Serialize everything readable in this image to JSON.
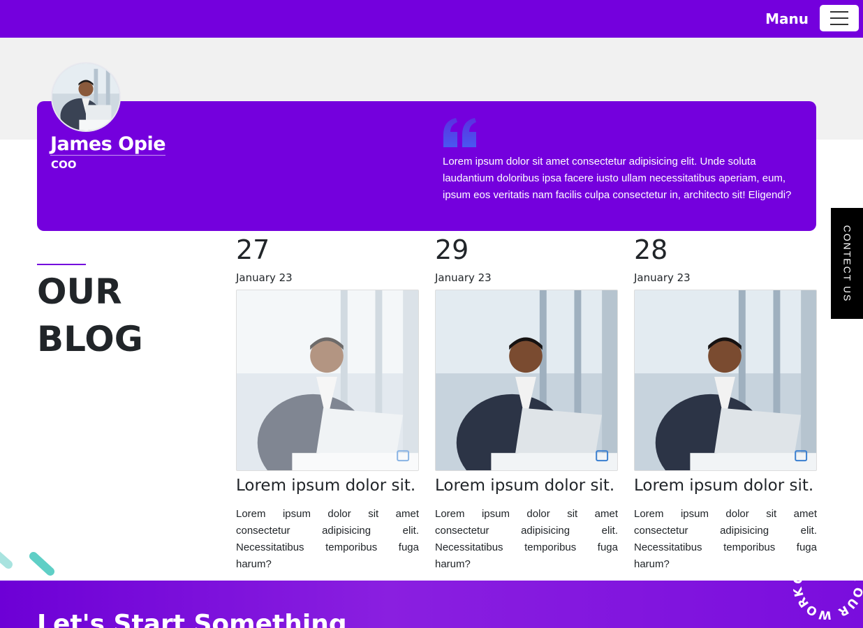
{
  "nav": {
    "menu_label": "Manu",
    "menu_icon": "hamburger-icon"
  },
  "testimonial": {
    "name": "James Opie",
    "role": "COO",
    "quote_icon": "quote-icon",
    "quote": "Lorem ipsum dolor sit amet consectetur adipisicing elit. Unde soluta laudantium doloribus ipsa facere iusto ullam necessitatibus aperiam, eum, ipsum eos veritatis nam facilis culpa consectetur in, architecto sit! Eligendi?"
  },
  "contact_tab": {
    "label": "CONTECT US"
  },
  "blog": {
    "heading_line1": "OUR",
    "heading_line2": "BLOG",
    "cards": [
      {
        "day": "27",
        "month": "January 23",
        "title": "Lorem ipsum dolor sit.",
        "body": "Lorem ipsum dolor sit amet consectetur adipisicing elit. Necessitatibus temporibus fuga harum?"
      },
      {
        "day": "29",
        "month": "January 23",
        "title": "Lorem ipsum dolor sit.",
        "body": "Lorem ipsum dolor sit amet consectetur adipisicing elit. Necessitatibus temporibus fuga harum?"
      },
      {
        "day": "28",
        "month": "January 23",
        "title": "Lorem ipsum dolor sit.",
        "body": "Lorem ipsum dolor sit amet consectetur adipisicing elit. Necessitatibus temporibus fuga harum?"
      }
    ]
  },
  "footer_band": {
    "title": "Let's Start Something",
    "badge_text": "OUR WORK OUR WORK"
  },
  "colors": {
    "brand": "#7400dd",
    "accent_teal": "#5fcfc6",
    "contact_tab_bg": "#000000"
  }
}
